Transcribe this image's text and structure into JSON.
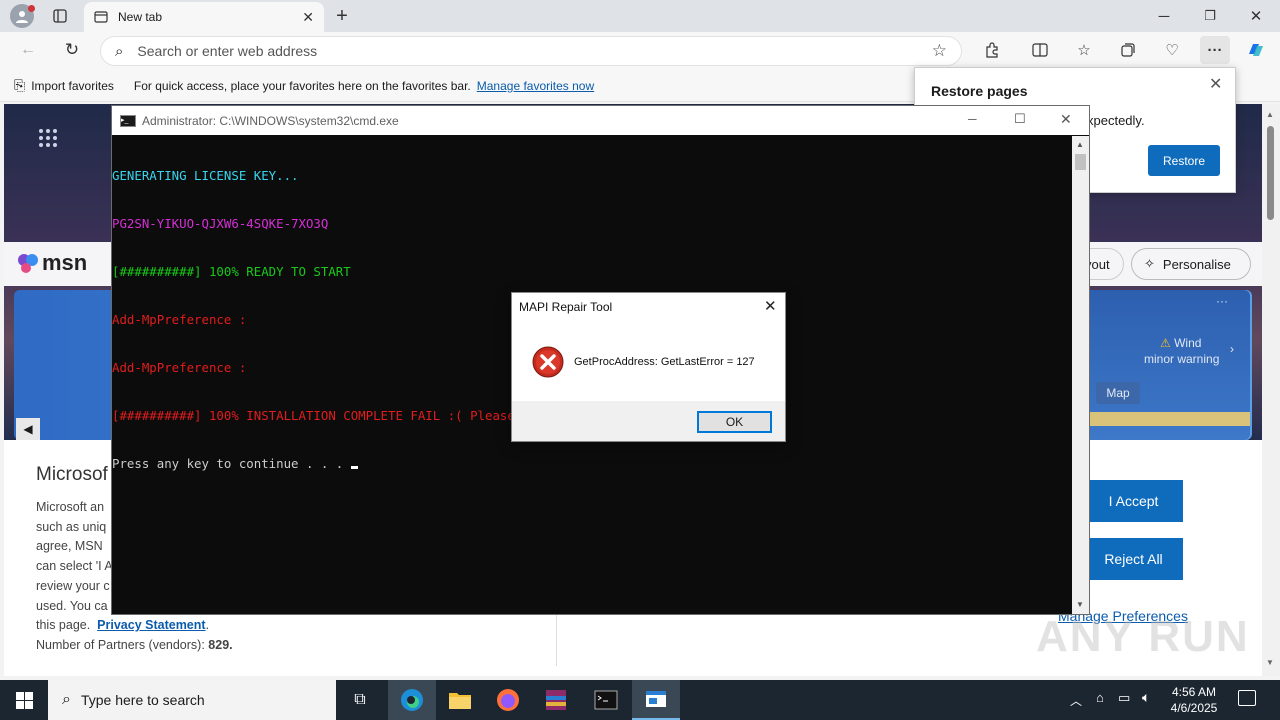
{
  "browser": {
    "tab_title": "New tab",
    "address_placeholder": "Search or enter web address",
    "favbar": {
      "import_label": "Import favorites",
      "hint": "For quick access, place your favorites here on the favorites bar.",
      "manage_link": "Manage favorites now"
    }
  },
  "restore_popup": {
    "title": "Restore pages",
    "text": "xpectedly.",
    "button": "Restore"
  },
  "msn": {
    "logo": "msn",
    "personalise": "Personalise",
    "layout_partial": "yout",
    "weather": {
      "label": "Wind",
      "sub": "minor warning",
      "map": "Map"
    }
  },
  "consent": {
    "title": "Microsof",
    "lines": [
      "Microsoft an",
      "such as uniq",
      "agree, MSN",
      "can select 'I A",
      "review your c",
      "used.  You ca"
    ],
    "line_last_prefix": "this page.",
    "privacy": "Privacy Statement",
    "partners_label": "Number of Partners (vendors):",
    "partners_count": "829.",
    "accept": "I Accept",
    "reject": "Reject All",
    "manage": "Manage Preferences"
  },
  "cmd": {
    "title": "Administrator: C:\\WINDOWS\\system32\\cmd.exe",
    "lines": [
      {
        "text": "GENERATING LICENSE KEY...",
        "color": "#3ad4ee"
      },
      {
        "text": "PG2SN-YIKUO-QJXW6-4SQKE-7XO3Q",
        "color": "#d62fd6"
      },
      {
        "text": "[##########] 100% READY TO START",
        "color": "#19c919"
      },
      {
        "text": "Add-MpPreference :",
        "color": "#e11d1d"
      },
      {
        "text": "Add-MpPreference :",
        "color": "#e11d1d"
      },
      {
        "text": "[##########] 100% INSTALLATION COMPLETE FAIL :( Please disable VPN and Antivirus",
        "color": "#e11d1d"
      },
      {
        "text": "Press any key to continue . . . ",
        "color": "#cccccc"
      }
    ]
  },
  "dialog": {
    "title": "MAPI Repair Tool",
    "message": "GetProcAddress: GetLastError = 127",
    "ok": "OK"
  },
  "taskbar": {
    "search_placeholder": "Type here to search",
    "time": "4:56 AM",
    "date": "4/6/2025"
  },
  "watermark": "ANY RUN"
}
